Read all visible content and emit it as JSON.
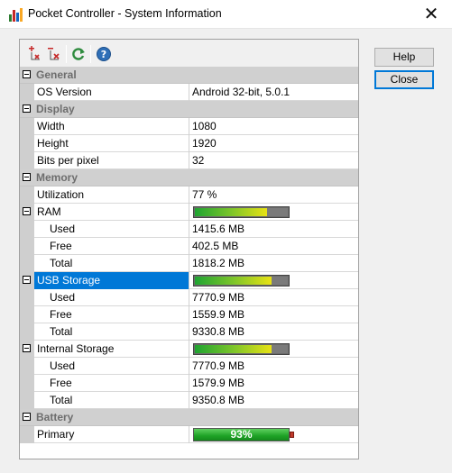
{
  "window": {
    "title": "Pocket Controller - System Information"
  },
  "toolbar": {
    "icons": [
      "expand-all-icon",
      "collapse-all-icon",
      "refresh-icon",
      "help-icon"
    ]
  },
  "buttons": {
    "help": "Help",
    "close": "Close"
  },
  "colors": {
    "accent": "#0078d7",
    "category_bg": "#d0d0d0",
    "battery_green": "#1ea326"
  },
  "sections": {
    "general": {
      "label": "General",
      "os_version": {
        "name": "OS Version",
        "value": "Android 32-bit, 5.0.1"
      }
    },
    "display": {
      "label": "Display",
      "width": {
        "name": "Width",
        "value": "1080"
      },
      "height": {
        "name": "Height",
        "value": "1920"
      },
      "bpp": {
        "name": "Bits per pixel",
        "value": "32"
      }
    },
    "memory": {
      "label": "Memory",
      "utilization": {
        "name": "Utilization",
        "value": "77 %"
      },
      "ram": {
        "name": "RAM",
        "usage_fraction": 0.78,
        "used": {
          "name": "Used",
          "value": "1415.6 MB"
        },
        "free": {
          "name": "Free",
          "value": "402.5 MB"
        },
        "total": {
          "name": "Total",
          "value": "1818.2 MB"
        }
      },
      "usb_storage": {
        "name": "USB Storage",
        "usage_fraction": 0.83,
        "used": {
          "name": "Used",
          "value": "7770.9 MB"
        },
        "free": {
          "name": "Free",
          "value": "1559.9 MB"
        },
        "total": {
          "name": "Total",
          "value": "9330.8 MB"
        }
      },
      "internal_storage": {
        "name": "Internal Storage",
        "usage_fraction": 0.83,
        "used": {
          "name": "Used",
          "value": "7770.9 MB"
        },
        "free": {
          "name": "Free",
          "value": "1579.9 MB"
        },
        "total": {
          "name": "Total",
          "value": "9350.8 MB"
        }
      }
    },
    "battery": {
      "label": "Battery",
      "primary": {
        "name": "Primary",
        "value": "93%",
        "level_fraction": 0.93
      }
    }
  }
}
